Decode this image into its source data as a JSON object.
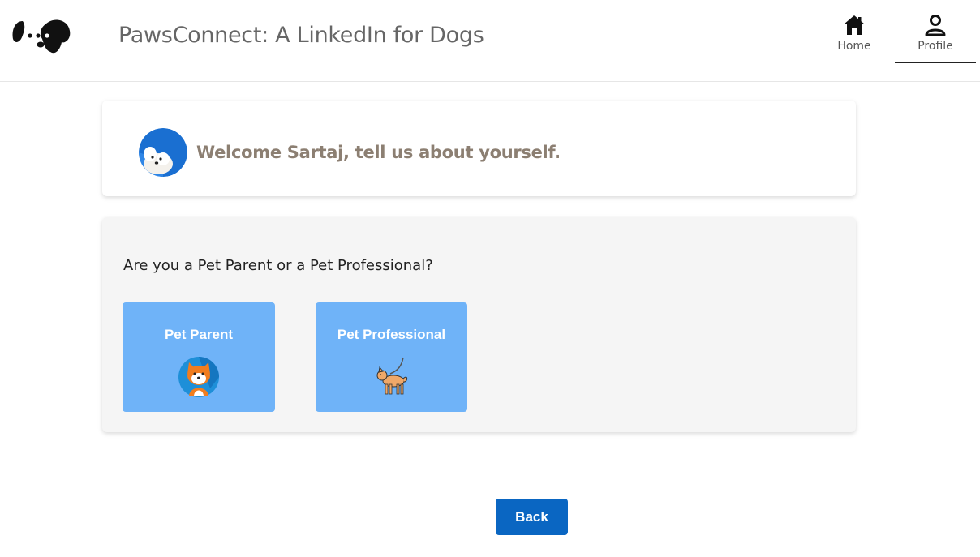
{
  "header": {
    "logo_icon": "dog-face-logo-icon",
    "title": "PawsConnect: A LinkedIn for Dogs",
    "nav": {
      "home": {
        "label": "Home",
        "icon": "home-icon"
      },
      "profile": {
        "label": "Profile",
        "icon": "person-icon",
        "active": true
      }
    }
  },
  "welcome": {
    "avatar_icon": "dog-avatar-icon",
    "text": "Welcome Sartaj, tell us about yourself."
  },
  "role_question": {
    "prompt": "Are you a Pet Parent or a Pet Professional?",
    "options": [
      {
        "label": "Pet Parent",
        "icon": "shiba-face-icon"
      },
      {
        "label": "Pet Professional",
        "icon": "dog-on-leash-icon"
      }
    ]
  },
  "footer": {
    "back_label": "Back"
  },
  "colors": {
    "option_bg": "#6fb3f8",
    "primary_button": "#0a66c2",
    "welcome_text": "#8c7f72",
    "question_card_bg": "#f5f5f5"
  }
}
